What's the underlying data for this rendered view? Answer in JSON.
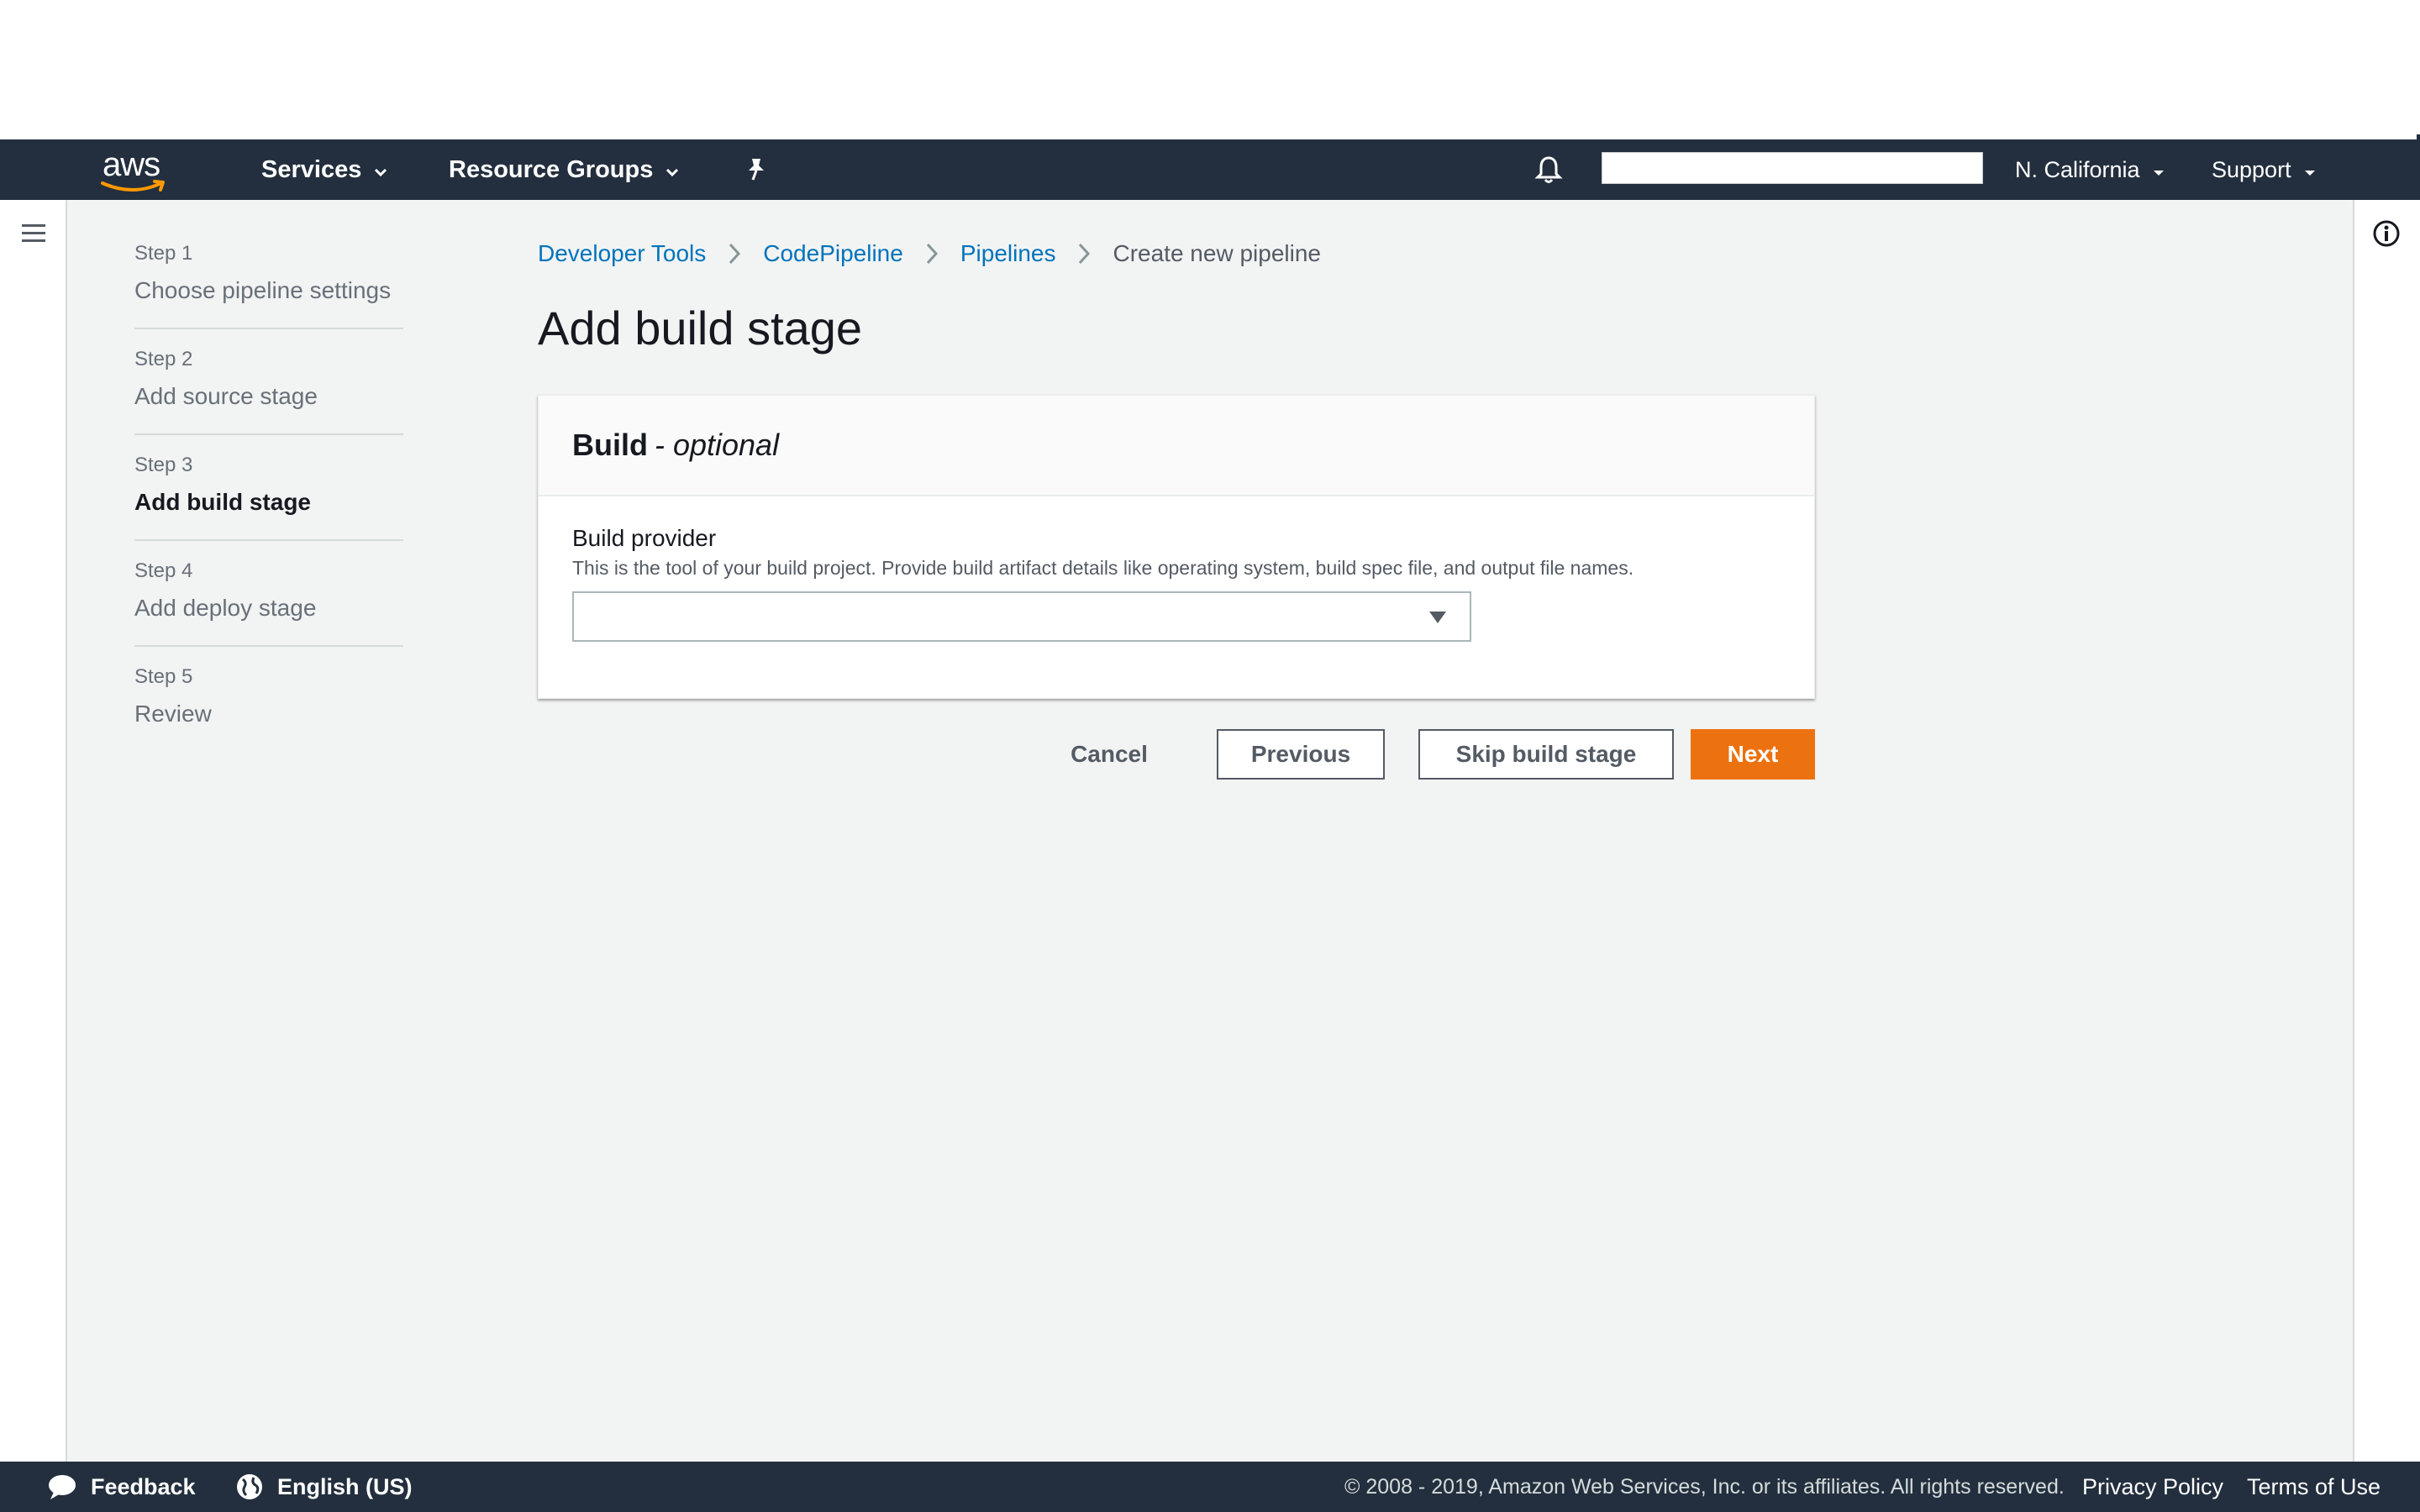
{
  "navbar": {
    "logo_text": "aws",
    "services_label": "Services",
    "resource_groups_label": "Resource Groups",
    "search_value": "",
    "region_label": "N. California",
    "support_label": "Support"
  },
  "steps": [
    {
      "number": "Step 1",
      "title": "Choose pipeline settings"
    },
    {
      "number": "Step 2",
      "title": "Add source stage"
    },
    {
      "number": "Step 3",
      "title": "Add build stage"
    },
    {
      "number": "Step 4",
      "title": "Add deploy stage"
    },
    {
      "number": "Step 5",
      "title": "Review"
    }
  ],
  "breadcrumb": {
    "items": [
      "Developer Tools",
      "CodePipeline",
      "Pipelines"
    ],
    "current": "Create new pipeline"
  },
  "page_title": "Add build stage",
  "panel": {
    "title": "Build",
    "title_suffix": "- optional",
    "field_label": "Build provider",
    "field_description": "This is the tool of your build project. Provide build artifact details like operating system, build spec file, and output file names.",
    "selected_value": ""
  },
  "actions": {
    "cancel": "Cancel",
    "previous": "Previous",
    "skip": "Skip build stage",
    "next": "Next"
  },
  "footer": {
    "feedback": "Feedback",
    "language": "English (US)",
    "copyright": "© 2008 - 2019, Amazon Web Services, Inc. or its affiliates. All rights reserved.",
    "privacy": "Privacy Policy",
    "terms": "Terms of Use"
  },
  "colors": {
    "navbar_bg": "#232f3e",
    "primary_button": "#ec7211",
    "link": "#0073bb",
    "page_bg": "#f2f3f3"
  }
}
